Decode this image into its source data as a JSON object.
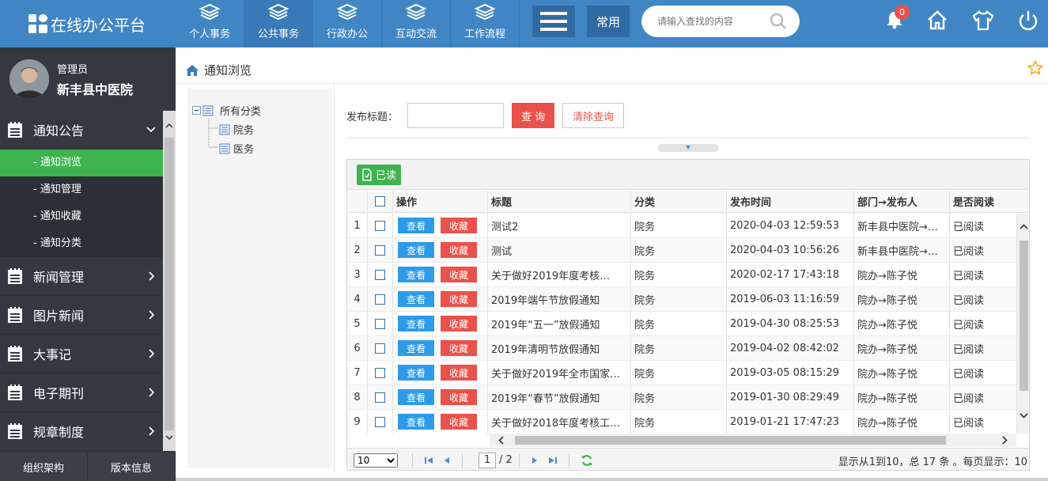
{
  "app": {
    "title": "在线办公平台"
  },
  "nav": [
    {
      "label": "个人事务"
    },
    {
      "label": "公共事务"
    },
    {
      "label": "行政办公"
    },
    {
      "label": "互动交流"
    },
    {
      "label": "工作流程"
    }
  ],
  "header": {
    "common_label": "常用",
    "search_placeholder": "请输入查找的内容",
    "notification_count": "0"
  },
  "user": {
    "role": "管理员",
    "org": "新丰县中医院"
  },
  "sidebar": {
    "groups": [
      {
        "label": "通知公告"
      },
      {
        "label": "新闻管理"
      },
      {
        "label": "图片新闻"
      },
      {
        "label": "大事记"
      },
      {
        "label": "电子期刊"
      },
      {
        "label": "规章制度"
      }
    ],
    "subitems": [
      {
        "label": "- 通知浏览"
      },
      {
        "label": "- 通知管理"
      },
      {
        "label": "- 通知收藏"
      },
      {
        "label": "- 通知分类"
      }
    ],
    "bottom": {
      "org_label": "组织架构",
      "version_label": "版本信息"
    }
  },
  "page": {
    "title": "通知浏览"
  },
  "tree": {
    "root": "所有分类",
    "children": [
      "院务",
      "医务"
    ]
  },
  "filter": {
    "label": "发布标题：",
    "query_label": "查 询",
    "clear_label": "清除查询"
  },
  "toolbar": {
    "read_label": "已读"
  },
  "table": {
    "columns": [
      "操作",
      "标题",
      "分类",
      "发布时间",
      "部门→发布人",
      "是否阅读"
    ],
    "view_label": "查看",
    "fav_label": "收藏",
    "rows": [
      {
        "no": "1",
        "title": "测试2",
        "category": "院务",
        "time": "2020-04-03 12:59:53",
        "dept": "新丰县中医院→…",
        "read": "已阅读"
      },
      {
        "no": "2",
        "title": "测试",
        "category": "院务",
        "time": "2020-04-03 10:56:26",
        "dept": "新丰县中医院→…",
        "read": "已阅读"
      },
      {
        "no": "3",
        "title": "关于做好2019年度考核…",
        "category": "院务",
        "time": "2020-02-17 17:43:18",
        "dept": "院办→陈子悦",
        "read": "已阅读"
      },
      {
        "no": "4",
        "title": "2019年端午节放假通知",
        "category": "院务",
        "time": "2019-06-03 11:16:59",
        "dept": "院办→陈子悦",
        "read": "已阅读"
      },
      {
        "no": "5",
        "title": "2019年“五一”放假通知",
        "category": "院务",
        "time": "2019-04-30 08:25:53",
        "dept": "院办→陈子悦",
        "read": "已阅读"
      },
      {
        "no": "6",
        "title": "2019年清明节放假通知",
        "category": "院务",
        "time": "2019-04-02 08:42:02",
        "dept": "院办→陈子悦",
        "read": "已阅读"
      },
      {
        "no": "7",
        "title": "关于做好2019年全市国家…",
        "category": "院务",
        "time": "2019-03-05 08:15:29",
        "dept": "院办→陈子悦",
        "read": "已阅读"
      },
      {
        "no": "8",
        "title": "2019年“春节”放假通知",
        "category": "院务",
        "time": "2019-01-30 08:29:49",
        "dept": "院办→陈子悦",
        "read": "已阅读"
      },
      {
        "no": "9",
        "title": "关于做好2018年度考核工…",
        "category": "院务",
        "time": "2019-01-21 17:47:23",
        "dept": "院办→陈子悦",
        "read": "已阅读"
      }
    ]
  },
  "pager": {
    "page_size": "10",
    "current_page": "1",
    "total_pages": "/ 2",
    "info": "显示从1到10，总 17 条 。每页显示：10"
  },
  "colors": {
    "primary": "#4186c4",
    "accent_red": "#e9524a",
    "accent_green": "#3fb34f",
    "view_blue": "#2e9be8",
    "sidebar_bg": "#33393f"
  }
}
